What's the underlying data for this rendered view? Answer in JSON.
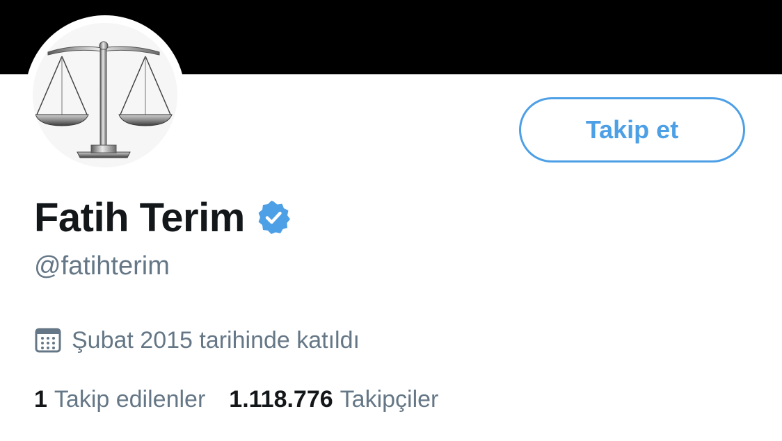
{
  "profile": {
    "name": "Fatih Terim",
    "handle": "@fatihterim",
    "verified": true,
    "joined": "Şubat 2015 tarihinde katıldı",
    "avatar_icon": "scales-of-justice-icon"
  },
  "actions": {
    "follow_label": "Takip et"
  },
  "stats": {
    "following_count": "1",
    "following_label": "Takip edilenler",
    "followers_count": "1.118.776",
    "followers_label": "Takipçiler"
  },
  "colors": {
    "accent": "#4d9fe6",
    "banner": "#000000",
    "text_primary": "#14171a",
    "text_secondary": "#657786"
  }
}
